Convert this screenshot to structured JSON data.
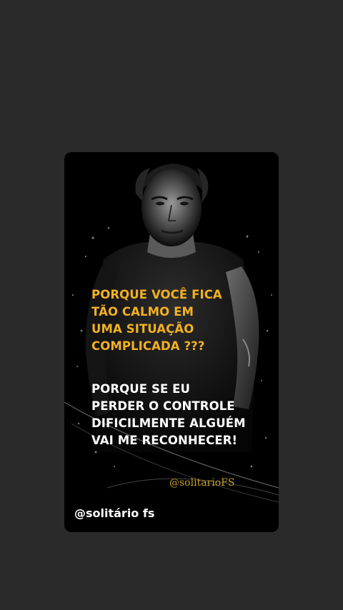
{
  "story": {
    "image": {
      "alt_icon": "portrait-photo"
    },
    "question_lines": [
      "PORQUE VOCÊ FICA",
      "TÃO CALMO EM",
      "UMA SITUAÇÃO",
      "COMPLICADA ???"
    ],
    "answer_lines": [
      "PORQUE SE EU",
      "PERDER O CONTROLE",
      "DIFICILMENTE ALGUÉM",
      "VAI ME RECONHECER!"
    ],
    "watermark": "@solitarioFS",
    "handle": "@solitário fs",
    "colors": {
      "background": "#2a2a2a",
      "card": "#000000",
      "question_text": "#f2b122",
      "answer_text": "#ffffff",
      "watermark": "#c9a227"
    }
  }
}
